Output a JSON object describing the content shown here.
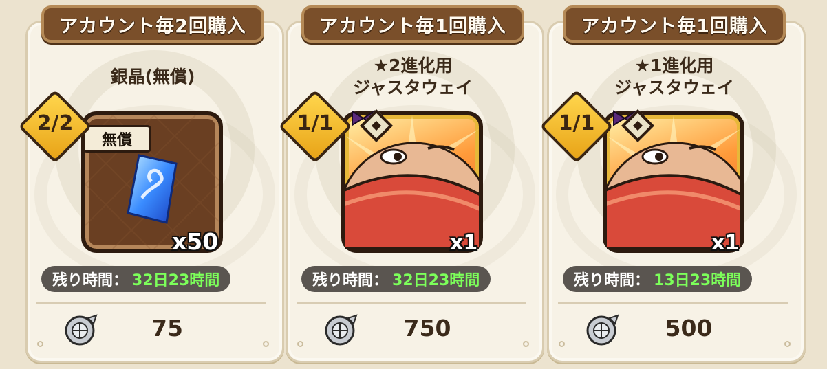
{
  "cards": [
    {
      "banner": "アカウント毎2回購入",
      "title": "銀晶(無償)",
      "limit": "2/2",
      "tag": "無償",
      "quantity": "x50",
      "remaining_label": "残り時間：",
      "remaining_value": "32日23時間",
      "price": "75",
      "icon": "blue-crystal-icon"
    },
    {
      "banner": "アカウント毎1回購入",
      "title": "★2進化用\nジャスタウェイ",
      "limit": "1/1",
      "quantity": "x1",
      "remaining_label": "残り時間：",
      "remaining_value": "32日23時間",
      "price": "750",
      "icon": "justaway-icon"
    },
    {
      "banner": "アカウント毎1回購入",
      "title": "★1進化用\nジャスタウェイ",
      "limit": "1/1",
      "quantity": "x1",
      "remaining_label": "残り時間：",
      "remaining_value": "13日23時間",
      "price": "500",
      "icon": "justaway-icon"
    }
  ],
  "colors": {
    "remaining_value": "#7cff5a",
    "banner": "#7a4f2a",
    "card_bg": "#f7f2e6"
  }
}
